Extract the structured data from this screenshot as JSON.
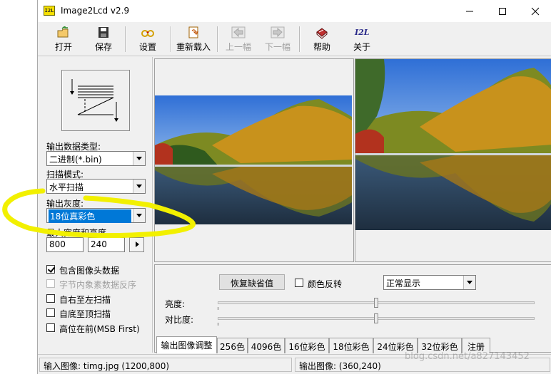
{
  "window": {
    "title": "Image2Lcd v2.9",
    "icon_text": "I2L"
  },
  "toolbar": {
    "open": "打开",
    "save": "保存",
    "settings": "设置",
    "reload": "重新载入",
    "prev": "上一幅",
    "next": "下一幅",
    "help": "帮助",
    "about": "关于",
    "about_icon_text": "I2L"
  },
  "left": {
    "output_type_label": "输出数据类型:",
    "output_type_value": "二进制(*.bin)",
    "scan_mode_label": "扫描模式:",
    "scan_mode_value": "水平扫描",
    "gray_label": "输出灰度:",
    "gray_value": "18位真彩色",
    "max_size_label": "最大宽度和高度",
    "max_width": "800",
    "max_height": "240",
    "checkboxes": [
      {
        "label": "包含图像头数据",
        "checked": true,
        "enabled": true
      },
      {
        "label": "字节内象素数据反序",
        "checked": false,
        "enabled": false
      },
      {
        "label": "自右至左扫描",
        "checked": false,
        "enabled": true
      },
      {
        "label": "自底至顶扫描",
        "checked": false,
        "enabled": true
      },
      {
        "label": "高位在前(MSB First)",
        "checked": false,
        "enabled": true
      }
    ]
  },
  "adjust": {
    "restore_default": "恢复缺省值",
    "invert_color": "颜色反转",
    "display_mode": "正常显示",
    "brightness_label": "亮度:",
    "contrast_label": "对比度:",
    "brightness_level": 0.5,
    "contrast_level": 0.5
  },
  "tabs": [
    "输出图像调整",
    "256色",
    "4096色",
    "16位彩色",
    "18位彩色",
    "24位彩色",
    "32位彩色",
    "注册"
  ],
  "status": {
    "input": "输入图像: timg.jpg (1200,800)",
    "output": "输出图像: (360,240)"
  },
  "watermark": "blog.csdn.net/a827143452",
  "colors": {
    "selection": "#0078d7",
    "highlight_marker": "#f2f000"
  }
}
